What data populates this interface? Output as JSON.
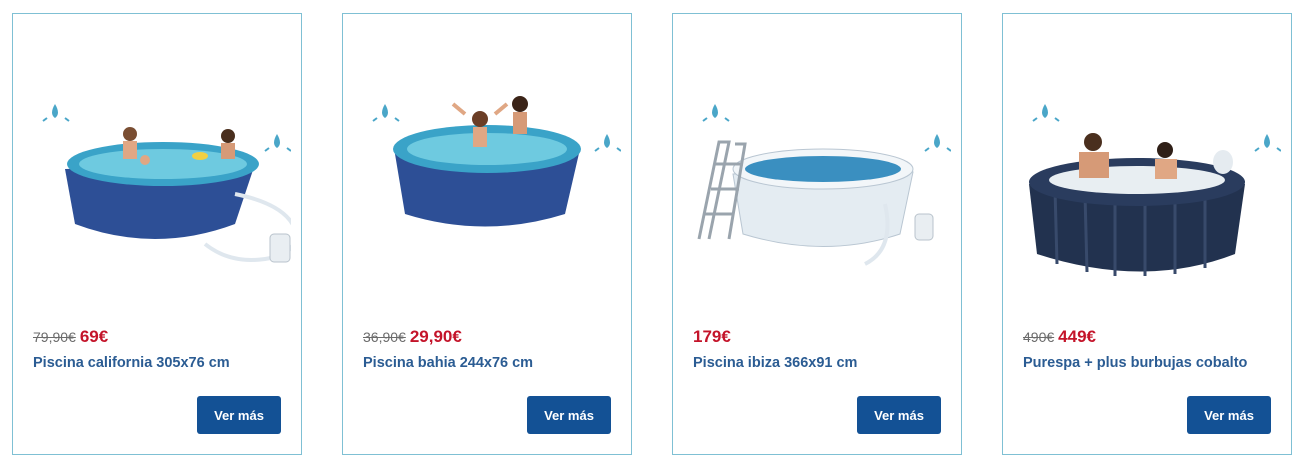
{
  "products": [
    {
      "old_price": "79,90€",
      "price": "69€",
      "name": "Piscina california 305x76 cm",
      "button_label": "Ver más",
      "image": "round-pool-with-filter-image"
    },
    {
      "old_price": "36,90€",
      "price": "29,90€",
      "name": "Piscina bahia 244x76 cm",
      "button_label": "Ver más",
      "image": "round-pool-image"
    },
    {
      "old_price": "",
      "price": "179€",
      "name": "Piscina ibiza 366x91 cm",
      "button_label": "Ver más",
      "image": "pool-with-ladder-image"
    },
    {
      "old_price": "490€",
      "price": "449€",
      "name": "Purespa + plus burbujas cobalto",
      "button_label": "Ver más",
      "image": "inflatable-spa-image"
    }
  ],
  "colors": {
    "accent": "#135195",
    "price": "#c4142a",
    "title": "#2b5c93",
    "border": "#7fc0d4",
    "splash": "#4aa6c8"
  }
}
